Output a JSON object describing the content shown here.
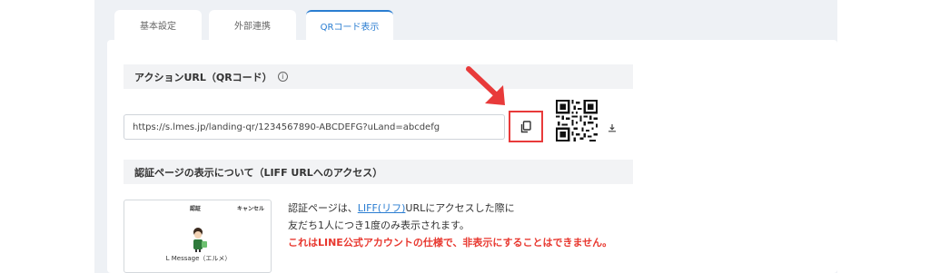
{
  "tabs": [
    {
      "label": "基本設定",
      "active": false
    },
    {
      "label": "外部連携",
      "active": false
    },
    {
      "label": "QRコード表示",
      "active": true
    }
  ],
  "action_url_section": {
    "title": "アクションURL（QRコード）",
    "info_icon": "info-icon",
    "url_value": "https://s.lmes.jp/landing-qr/1234567890-ABCDEFG?uLand=abcdefg",
    "copy_icon": "copy-icon",
    "download_icon": "download-icon",
    "highlight_color": "#e83a3a"
  },
  "auth_section": {
    "title": "認証ページの表示について（LIFF URLへのアクセス）",
    "preview": {
      "header_title": "認証",
      "cancel_label": "キャンセル",
      "account_name": "L Message（エルメ）"
    },
    "line1_prefix": "認証ページは、",
    "line1_link": "LIFF(リフ)",
    "line1_suffix": "URLにアクセスした際に",
    "line2": "友だち1人につき1度のみ表示されます。",
    "warning": "これはLINE公式アカウントの仕様で、非表示にすることはできません。"
  },
  "colors": {
    "accent": "#2a7dd1",
    "warning": "#e8382f",
    "background": "#eef1f5"
  }
}
